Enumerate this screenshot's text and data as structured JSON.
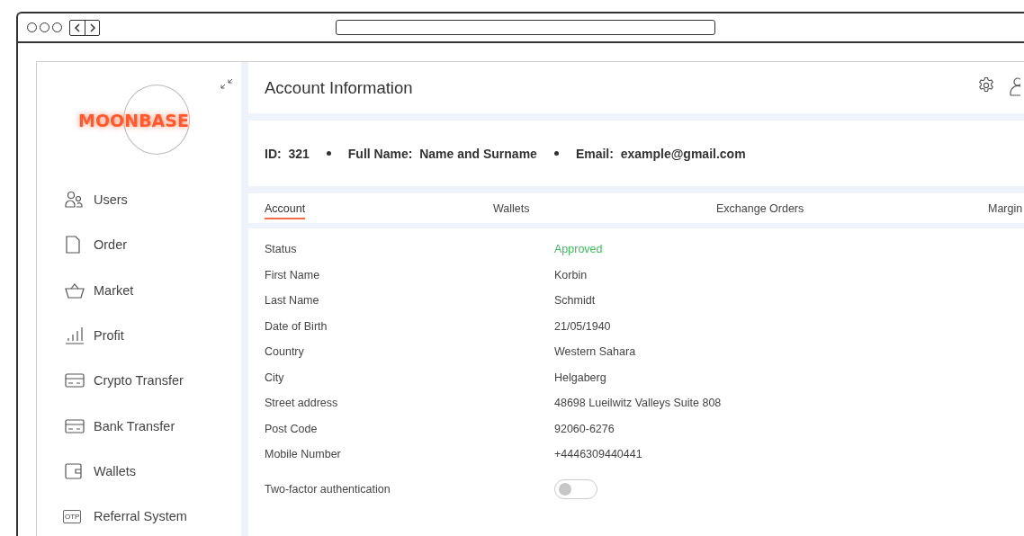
{
  "logo": {
    "text": "MOONBASE"
  },
  "sidebar": {
    "items": [
      {
        "label": "Users"
      },
      {
        "label": "Order"
      },
      {
        "label": "Market"
      },
      {
        "label": "Profit"
      },
      {
        "label": "Crypto Transfer"
      },
      {
        "label": "Bank Transfer"
      },
      {
        "label": "Wallets"
      },
      {
        "label": "Referral System",
        "icon_text": "OTP"
      }
    ]
  },
  "header": {
    "title": "Account Information"
  },
  "summary": [
    {
      "label": "ID:",
      "value": "321"
    },
    {
      "label": "Full Name:",
      "value": "Name and Surname"
    },
    {
      "label": "Email:",
      "value": "example@gmail.com"
    }
  ],
  "tabs": [
    {
      "label": "Account",
      "selected": true
    },
    {
      "label": "Wallets",
      "selected": false
    },
    {
      "label": "Exchange Orders",
      "selected": false
    },
    {
      "label": "Margin",
      "selected": false
    }
  ],
  "fields": [
    {
      "kind": "status",
      "label": "Status",
      "value": "Approved"
    },
    {
      "kind": "text",
      "label": "First Name",
      "value": "Korbin"
    },
    {
      "kind": "text",
      "label": "Last Name",
      "value": "Schmidt"
    },
    {
      "kind": "text",
      "label": "Date of Birth",
      "value": "21/05/1940"
    },
    {
      "kind": "text",
      "label": "Country",
      "value": "Western Sahara"
    },
    {
      "kind": "text",
      "label": "City",
      "value": "Helgaberg"
    },
    {
      "kind": "text",
      "label": "Street address",
      "value": "48698 Lueilwitz Valleys Suite 808"
    },
    {
      "kind": "text",
      "label": "Post Code",
      "value": "92060-6276"
    },
    {
      "kind": "text",
      "label": "Mobile Number",
      "value": "+4446309440441"
    },
    {
      "kind": "toggle",
      "label": "Two-factor authentication",
      "on": false
    }
  ]
}
